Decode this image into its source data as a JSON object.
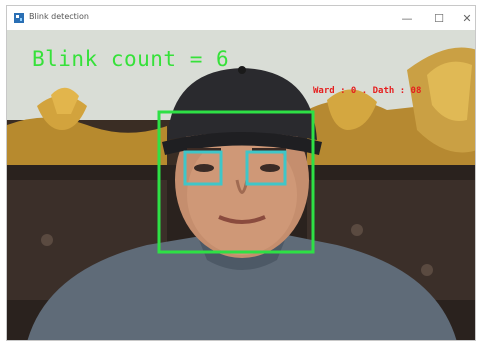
{
  "window": {
    "title": "Blink detection",
    "controls": {
      "minimize": "—",
      "maximize": "☐",
      "close": "✕"
    },
    "app_icon": "opencv-window-icon"
  },
  "overlay": {
    "blink_count_text": "Blink count = 6",
    "metrics_text": "Ward : 0 . Dath : 08",
    "colors": {
      "blink_text": "#36e13a",
      "metrics_text": "#e51f1f",
      "face_box": "#2ee045",
      "eye_box": "#3fc6c8"
    }
  }
}
